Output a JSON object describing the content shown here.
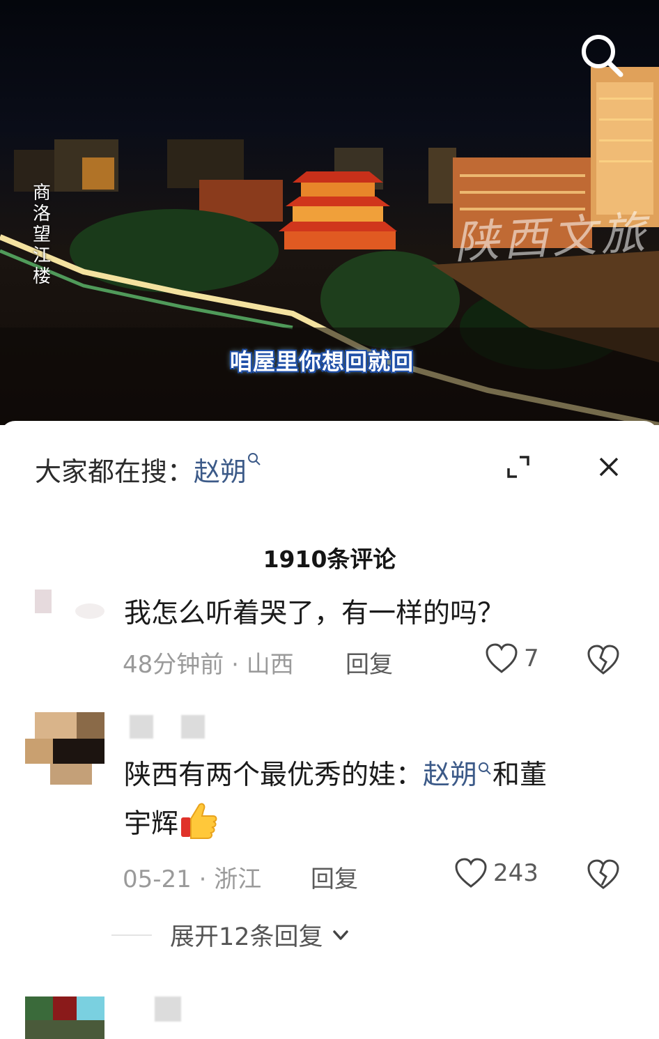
{
  "video": {
    "vertical_title": [
      "商",
      "洛",
      "望",
      "江",
      "楼"
    ],
    "watermark": "陕西文旅",
    "subtitle": "咱屋里你想回就回",
    "icons": {
      "search": "search-icon"
    }
  },
  "panel": {
    "hot_search_label": "大家都在搜：",
    "hot_search_term": "赵朔",
    "icons": {
      "expand": "expand-icon",
      "close": "close-icon"
    },
    "comment_count": "1910条评论"
  },
  "comments": [
    {
      "text": "我怎么听着哭了，有一样的吗？",
      "time": "48分钟前",
      "location": "山西",
      "reply_label": "回复",
      "likes": "7"
    },
    {
      "text_before": "陕西有两个最优秀的娃：",
      "mention": "赵朔",
      "text_after_line1": "和董",
      "text_line2": "宇辉",
      "emoji": "thumbs-up-emoji",
      "time": "05-21",
      "location": "浙江",
      "reply_label": "回复",
      "likes": "243",
      "expand_replies": "展开12条回复"
    }
  ],
  "colors": {
    "mention": "#3c5a88",
    "meta": "#9a9a9a"
  }
}
